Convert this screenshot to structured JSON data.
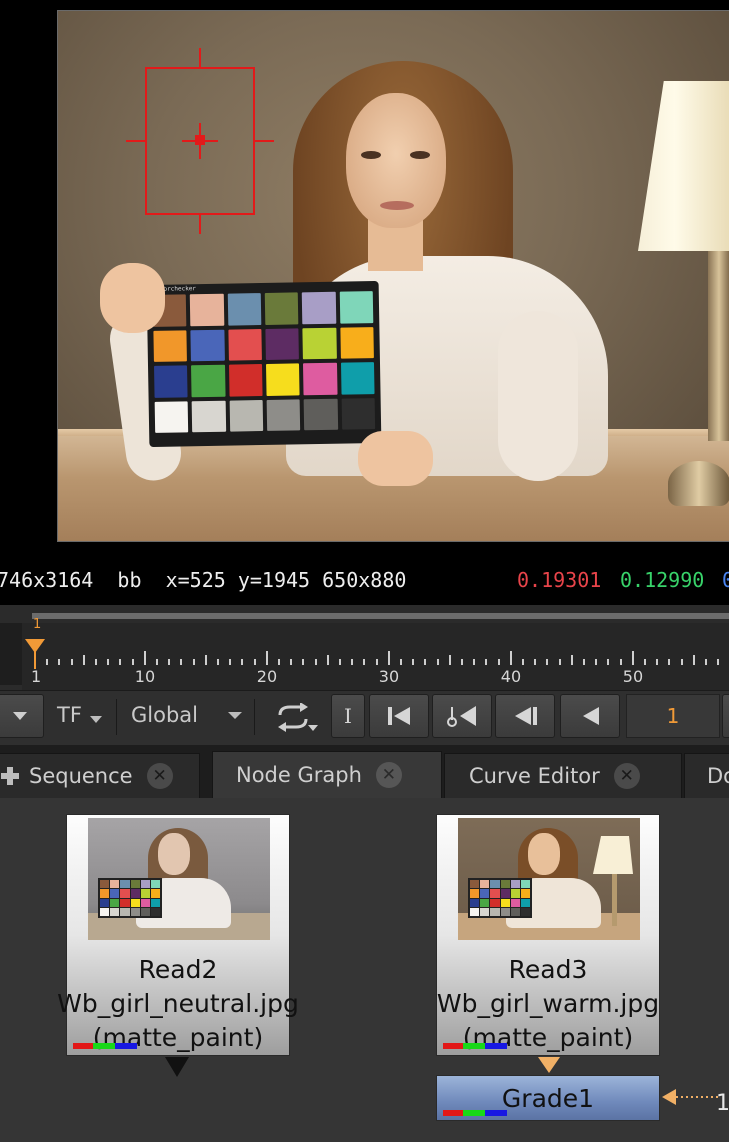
{
  "viewer": {
    "checker_label": "colorchecker",
    "checker_colors": [
      "#8a5a3c",
      "#e7b39b",
      "#6b8fae",
      "#6a7a3a",
      "#a89ec6",
      "#7fd6b9",
      "#f1972a",
      "#4a66b9",
      "#e34f4f",
      "#5d2c63",
      "#b9d234",
      "#f8ae1b",
      "#2a3e8f",
      "#4aa645",
      "#d12e2a",
      "#f6dd1d",
      "#de5ca0",
      "#0f9eaa",
      "#f6f4f0",
      "#d8d6d0",
      "#b8b7b0",
      "#8e8d89",
      "#5f5e5b",
      "#2e2e2e"
    ],
    "focus_color": "#e21a1a"
  },
  "infobar": {
    "left_text": "746x3164  bb  x=525 y=1945 650x880",
    "r_value": "0.19301",
    "g_value": "0.12990",
    "b_value": "0"
  },
  "timeline": {
    "current_frame": "1",
    "tick_labels": [
      "1",
      "10",
      "20",
      "30",
      "40",
      "50"
    ]
  },
  "transport": {
    "tf_label": "TF",
    "global_label": "Global",
    "frame_value": "1",
    "icons": [
      "dropdown-arrow-icon",
      "loop-icon",
      "in-point-icon",
      "go-to-start-icon",
      "previous-keyframe-icon",
      "step-back-icon",
      "play-backward-icon"
    ]
  },
  "tabs": [
    {
      "label": "Sequence",
      "active": false
    },
    {
      "label": "Node Graph",
      "active": true
    },
    {
      "label": "Curve Editor",
      "active": false
    },
    {
      "label": "Do",
      "active": false
    }
  ],
  "nodes": [
    {
      "title": "Read2",
      "file": "Wb_girl_neutral.jpg",
      "layer": "(matte_paint)"
    },
    {
      "title": "Read3",
      "file": "Wb_girl_warm.jpg",
      "layer": "(matte_paint)"
    },
    {
      "title": "Grade1"
    }
  ],
  "node_graph": {
    "edge_label": "1"
  },
  "colors": {
    "accent": "#f19a37",
    "red": "#e8444a",
    "green": "#38d36a",
    "blue": "#4a84f0"
  }
}
